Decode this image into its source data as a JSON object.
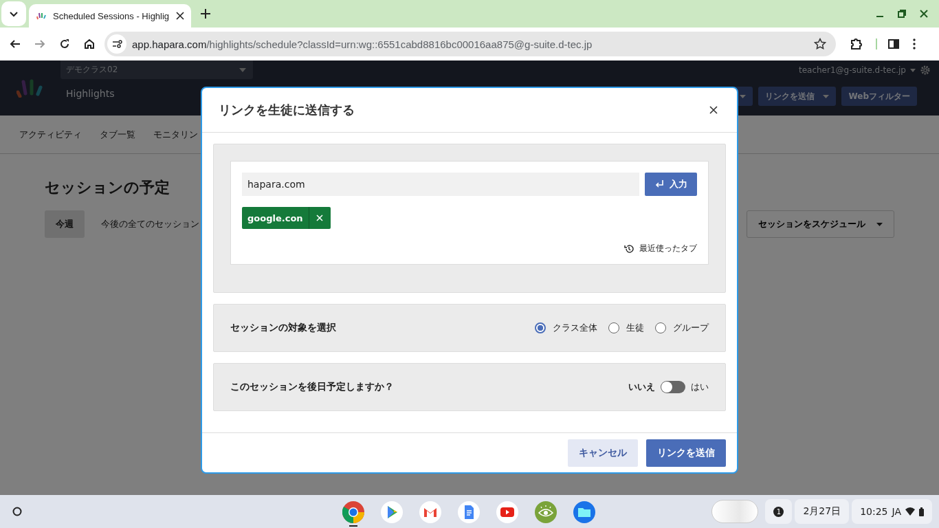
{
  "browser": {
    "tab_title": "Scheduled Sessions - Highlig",
    "url_host": "app.hapara.com",
    "url_path": "/highlights/schedule?classId=urn:wg::6551cabd8816bc00016aa875@g-suite.d-tec.jp"
  },
  "header": {
    "class_select": "デモクラス02",
    "app_name": "Highlights",
    "account": "teacher1@g-suite.d-tec.jp",
    "buttons": [
      {
        "label": "リンクを送信",
        "dropdown": true
      },
      {
        "label": "Webフィルター",
        "dropdown": false
      }
    ]
  },
  "nav": [
    "アクティビティ",
    "タブ一覧",
    "モニタリン"
  ],
  "page": {
    "title": "セッションの予定",
    "tabs": [
      {
        "label": "今週",
        "selected": true
      },
      {
        "label": "今後の全てのセッション",
        "selected": false
      }
    ],
    "schedule_button": "セッションをスケジュール"
  },
  "dialog": {
    "title": "リンクを生徒に送信する",
    "url_input": {
      "value": "hapara.com"
    },
    "enter_button": "入力",
    "links": [
      {
        "label": "google.con"
      }
    ],
    "recent_tabs": "最近使ったタブ",
    "target": {
      "label": "セッションの対象を選択",
      "options": [
        {
          "label": "クラス全体",
          "selected": true
        },
        {
          "label": "生徒",
          "selected": false
        },
        {
          "label": "グループ",
          "selected": false
        }
      ]
    },
    "schedule": {
      "label": "このセッションを後日予定しますか？",
      "off_label": "いいえ",
      "on_label": "はい",
      "on": false
    },
    "buttons": [
      {
        "label": "キャンセル",
        "kind": "secondary"
      },
      {
        "label": "リンクを送信",
        "kind": "primary"
      }
    ]
  },
  "shelf": {
    "apps": [
      {
        "kind": "chrome",
        "active": true
      },
      {
        "kind": "play",
        "active": false
      },
      {
        "kind": "gmail",
        "active": false
      },
      {
        "kind": "docs",
        "active": false
      },
      {
        "kind": "youtube",
        "active": false
      },
      {
        "kind": "eye",
        "active": false
      },
      {
        "kind": "files",
        "active": false
      }
    ],
    "notifications": "1",
    "date": "2月27日",
    "time": "10:25",
    "ime": "JA"
  }
}
